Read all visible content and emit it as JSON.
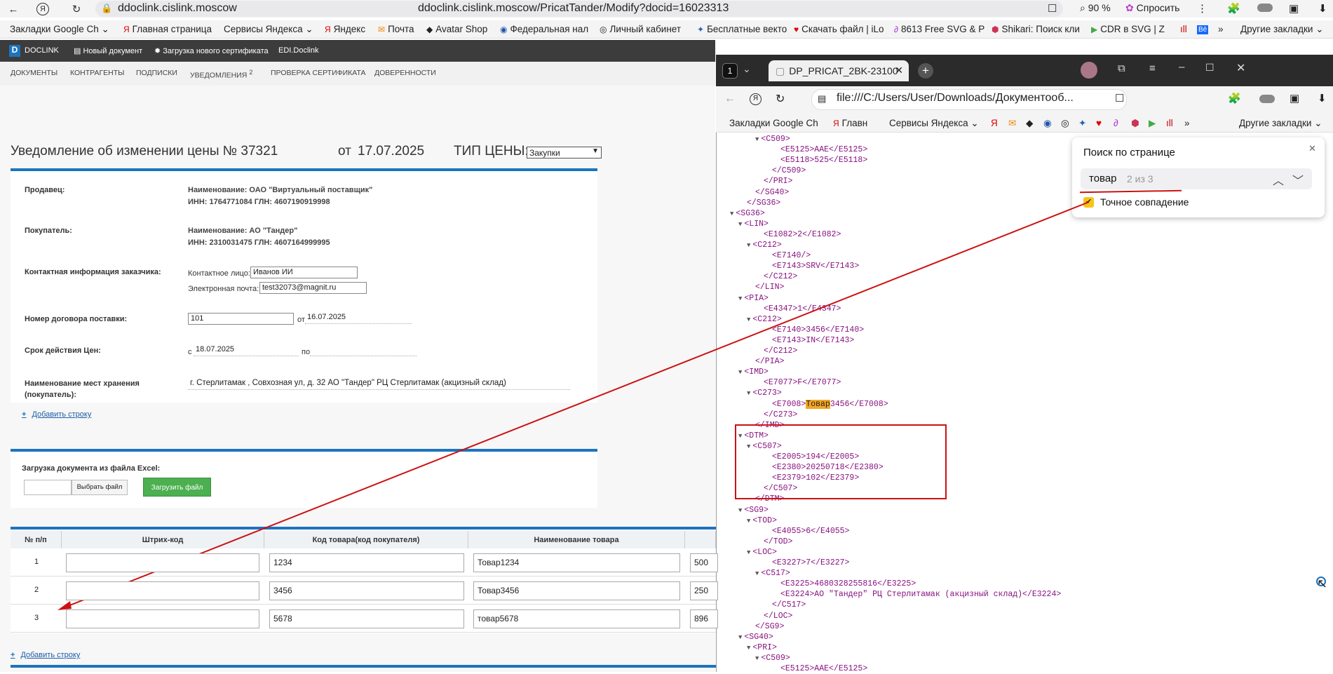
{
  "browser": {
    "url_host": "ddoclink.cislink.moscow",
    "url_full": "ddoclink.cislink.moscow/PricatTander/Modify?docid=16023313",
    "zoom": "90 %",
    "ask_label": "Спросить"
  },
  "bookmarks": [
    "Закладки Google Ch",
    "Главная страница",
    "Сервисы Яндекса",
    "Яндекс",
    "Почта",
    "Avatar Shop",
    "Федеральная нал",
    "Личный кабинет",
    "Бесплатные векто",
    "Скачать файл | iLo",
    "8613 Free SVG & P",
    "Shikari: Поиск кли",
    "CDR в SVG | Z",
    "Другие закладки"
  ],
  "docklink": {
    "logo": "DOCLINK",
    "new_doc": "Новый документ",
    "upload_cert": "Загрузка нового сертификата",
    "edi": "EDI.Doclink"
  },
  "nav": {
    "documents": "ДОКУМЕНТЫ",
    "contractors": "КОНТРАГЕНТЫ",
    "signatures": "ПОДПИСКИ",
    "notifications": "УВЕДОМЛЕНИЯ",
    "notif_count": "2",
    "cert_check": "ПРОВЕРКА СЕРТИФИКАТА",
    "powers": "ДОВЕРЕННОСТИ"
  },
  "form": {
    "title": "Уведомление об изменении цены №",
    "number": "37321",
    "from_label": "от",
    "date": "17.07.2025",
    "price_type_label": "ТИП ЦЕНЫ:",
    "price_type": "Закупки",
    "seller_label": "Продавец:",
    "seller_name": "Наименование: ОАО \"Виртуальный поставщик\"",
    "seller_ids": "ИНН: 1764771084 ГЛН: 4607190919998",
    "buyer_label": "Покупатель:",
    "buyer_name": "Наименование: АО \"Тандер\"",
    "buyer_ids": "ИНН: 2310031475 ГЛН: 4607164999995",
    "contact_label": "Контактная информация заказчика:",
    "contact_person_label": "Контактное лицо:",
    "contact_person": "Иванов ИИ",
    "email_label": "Электронная почта:",
    "email": "test32073@magnit.ru",
    "contract_label": "Номер договора поставки:",
    "contract_number": "101",
    "contract_from": "от",
    "contract_date": "16.07.2025",
    "validity_label": "Срок действия Цен:",
    "validity_from_label": "с",
    "validity_from": "18.07.2025",
    "validity_to_label": "по",
    "storage_label": "Наименование мест хранения",
    "storage_label2": "(покупатель):",
    "storage_value": "г. Стерлитамак , Совхозная ул, д. 32 АО \"Тандер\" РЦ Стерлитамак (акцизный склад)",
    "add_row": "Добавить строку",
    "excel_label": "Загрузка документа из файла Excel:",
    "choose_file": "Выбрать файл",
    "upload_file": "Загрузить файл"
  },
  "table": {
    "headers": [
      "№ п/п",
      "Штрих-код",
      "Код товара(код покупателя)",
      "Наименование товара"
    ],
    "rows": [
      {
        "n": "1",
        "code": "1234",
        "name": "Товар1234",
        "qty": "500"
      },
      {
        "n": "2",
        "code": "3456",
        "name": "Товар3456",
        "qty": "250"
      },
      {
        "n": "3",
        "code": "5678",
        "name": "товар5678",
        "qty": "896"
      }
    ],
    "add_row": "Добавить строку"
  },
  "win2": {
    "tab_count": "1",
    "tab_title": "DP_PRICAT_2BK-23100",
    "url": "file:///C:/Users/User/Downloads/Документооб...",
    "bm_first": "Закладки Google Ch",
    "bm_glav": "Главн",
    "bm_services": "Сервисы Яндекса",
    "bm_other": "Другие закладки"
  },
  "find": {
    "title": "Поиск по странице",
    "query": "товар",
    "count": "2 из 3",
    "exact": "Точное совпадение"
  },
  "xml_lines": [
    {
      "i": 5,
      "tri": true,
      "text": "<C509>"
    },
    {
      "i": 7,
      "text": "<E5125>AAE</E5125>"
    },
    {
      "i": 7,
      "text": "<E5118>525</E5118>"
    },
    {
      "i": 6,
      "text": "</C509>"
    },
    {
      "i": 5,
      "text": "</PRI>"
    },
    {
      "i": 4,
      "text": "</SG40>"
    },
    {
      "i": 3,
      "text": "</SG36>"
    },
    {
      "i": 2,
      "tri": true,
      "text": "<SG36>"
    },
    {
      "i": 3,
      "tri": true,
      "text": "<LIN>"
    },
    {
      "i": 5,
      "text": "<E1082>2</E1082>"
    },
    {
      "i": 4,
      "tri": true,
      "text": "<C212>"
    },
    {
      "i": 6,
      "text": "<E7140/>"
    },
    {
      "i": 6,
      "text": "<E7143>SRV</E7143>"
    },
    {
      "i": 5,
      "text": "</C212>"
    },
    {
      "i": 4,
      "text": "</LIN>"
    },
    {
      "i": 3,
      "tri": true,
      "text": "<PIA>"
    },
    {
      "i": 5,
      "text": "<E4347>1</E4347>"
    },
    {
      "i": 4,
      "tri": true,
      "text": "<C212>"
    },
    {
      "i": 6,
      "text": "<E7140>3456</E7140>"
    },
    {
      "i": 6,
      "text": "<E7143>IN</E7143>"
    },
    {
      "i": 5,
      "text": "</C212>"
    },
    {
      "i": 4,
      "text": "</PIA>"
    },
    {
      "i": 3,
      "tri": true,
      "text": "<IMD>"
    },
    {
      "i": 5,
      "text": "<E7077>F</E7077>"
    },
    {
      "i": 4,
      "tri": true,
      "text": "<C273>"
    },
    {
      "i": 6,
      "hl": true,
      "pre": "<E7008>",
      "mark": "Товар",
      "post": "3456</E7008>"
    },
    {
      "i": 5,
      "text": "</C273>"
    },
    {
      "i": 4,
      "text": "</IMD>"
    },
    {
      "i": 3,
      "tri": true,
      "text": "<DTM>"
    },
    {
      "i": 4,
      "tri": true,
      "text": "<C507>"
    },
    {
      "i": 6,
      "text": "<E2005>194</E2005>"
    },
    {
      "i": 6,
      "text": "<E2380>20250718</E2380>"
    },
    {
      "i": 6,
      "text": "<E2379>102</E2379>"
    },
    {
      "i": 5,
      "text": "</C507>"
    },
    {
      "i": 4,
      "text": "</DTM>"
    },
    {
      "i": 3,
      "tri": true,
      "text": "<SG9>"
    },
    {
      "i": 4,
      "tri": true,
      "text": "<TOD>"
    },
    {
      "i": 6,
      "text": "<E4055>6</E4055>"
    },
    {
      "i": 5,
      "text": "</TOD>"
    },
    {
      "i": 4,
      "tri": true,
      "text": "<LOC>"
    },
    {
      "i": 6,
      "text": "<E3227>7</E3227>"
    },
    {
      "i": 5,
      "tri": true,
      "text": "<C517>"
    },
    {
      "i": 7,
      "text": "<E3225>4680328255816</E3225>"
    },
    {
      "i": 7,
      "text": "<E3224>АО \"Тандер\" РЦ Стерлитамак (акцизный склад)</E3224>"
    },
    {
      "i": 6,
      "text": "</C517>"
    },
    {
      "i": 5,
      "text": "</LOC>"
    },
    {
      "i": 4,
      "text": "</SG9>"
    },
    {
      "i": 3,
      "tri": true,
      "text": "<SG40>"
    },
    {
      "i": 4,
      "tri": true,
      "text": "<PRI>"
    },
    {
      "i": 5,
      "tri": true,
      "text": "<C509>"
    },
    {
      "i": 7,
      "text": "<E5125>AAE</E5125>"
    }
  ]
}
